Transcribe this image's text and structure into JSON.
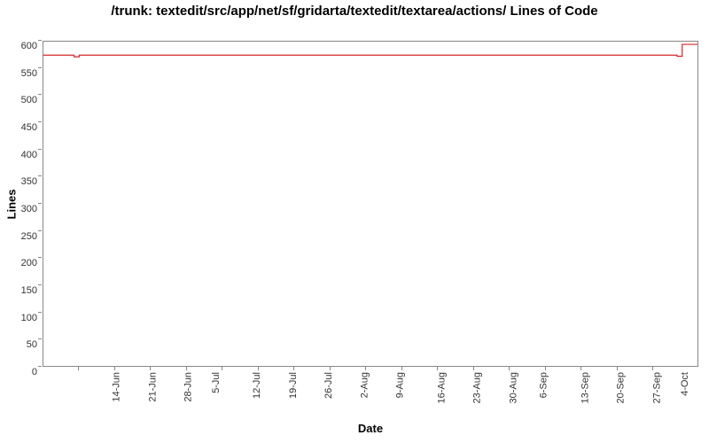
{
  "chart_data": {
    "type": "line",
    "title": "/trunk: textedit/src/app/net/sf/gridarta/textedit/textarea/actions/ Lines of Code",
    "xlabel": "Date",
    "ylabel": "Lines",
    "ylim": [
      0,
      600
    ],
    "y_ticks": [
      0,
      50,
      100,
      150,
      200,
      250,
      300,
      350,
      400,
      450,
      500,
      550,
      600
    ],
    "x_ticks": [
      "14-Jun",
      "21-Jun",
      "28-Jun",
      "5-Jul",
      "12-Jul",
      "19-Jul",
      "26-Jul",
      "2-Aug",
      "9-Aug",
      "16-Aug",
      "23-Aug",
      "30-Aug",
      "6-Sep",
      "13-Sep",
      "20-Sep",
      "27-Sep",
      "4-Oct"
    ],
    "x_range_days": 128,
    "x_start_day": 0,
    "series": [
      {
        "name": "Lines of Code",
        "color": "#d62728",
        "points": [
          {
            "day": 0,
            "value": 575
          },
          {
            "day": 6,
            "value": 575
          },
          {
            "day": 6,
            "value": 572
          },
          {
            "day": 7,
            "value": 572
          },
          {
            "day": 7,
            "value": 575
          },
          {
            "day": 124,
            "value": 575
          },
          {
            "day": 124,
            "value": 573
          },
          {
            "day": 125,
            "value": 573
          },
          {
            "day": 125,
            "value": 595
          },
          {
            "day": 128,
            "value": 595
          }
        ]
      }
    ]
  }
}
